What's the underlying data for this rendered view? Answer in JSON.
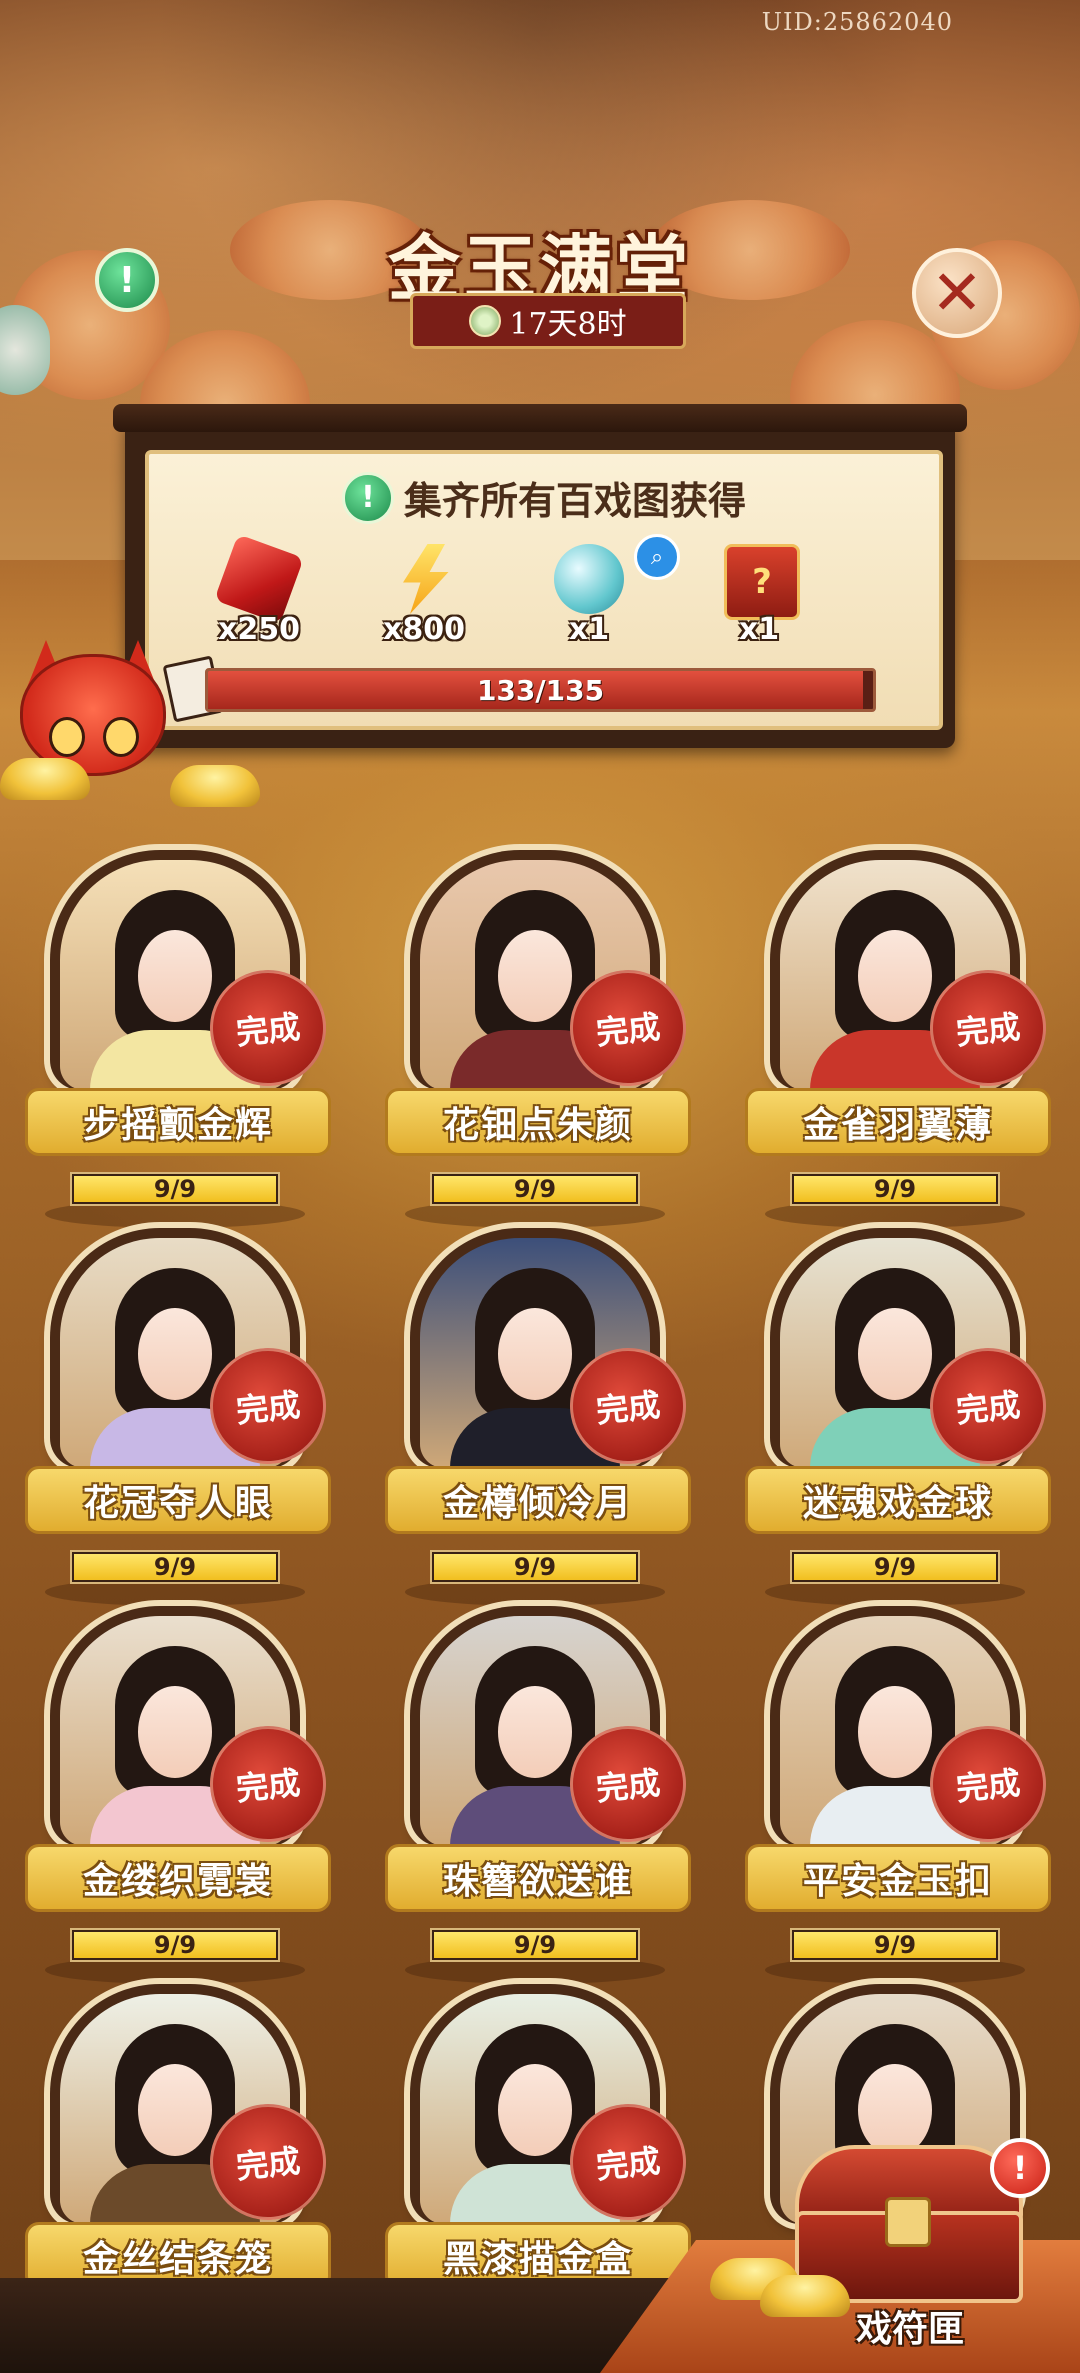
{
  "header": {
    "uid": "UID:25862040",
    "title": "金玉满堂",
    "timer": "17天8时"
  },
  "reward_panel": {
    "heading": "集齐所有百戏图获得",
    "rewards": [
      {
        "icon": "red-gem-icon",
        "qty": "x250"
      },
      {
        "icon": "lightning-icon",
        "qty": "x800"
      },
      {
        "icon": "spirit-orb-icon",
        "qty": "x1"
      },
      {
        "icon": "mystery-chest-icon",
        "qty": "x1"
      }
    ],
    "progress": {
      "text": "133/135",
      "current": 133,
      "total": 135
    }
  },
  "colors": {
    "accent_red": "#a8221a",
    "gold": "#f1bf1f",
    "panel": "#fbf1d7"
  },
  "cards": [
    {
      "name": "步摇颤金辉",
      "status": "完成",
      "progress": "9/9",
      "fraction": 1,
      "skin": "#f5e0b8",
      "outfit": "#f3e6a2"
    },
    {
      "name": "花钿点朱颜",
      "status": "完成",
      "progress": "9/9",
      "fraction": 1,
      "skin": "#e9c8ad",
      "outfit": "#7a2a2a"
    },
    {
      "name": "金雀羽翼薄",
      "status": "完成",
      "progress": "9/9",
      "fraction": 1,
      "skin": "#f0e2cc",
      "outfit": "#c9362a"
    },
    {
      "name": "花冠夺人眼",
      "status": "完成",
      "progress": "9/9",
      "fraction": 1,
      "skin": "#e8dcc6",
      "outfit": "#c8b8e6"
    },
    {
      "name": "金樽倾冷月",
      "status": "完成",
      "progress": "9/9",
      "fraction": 1,
      "skin": "#3c4f7a",
      "outfit": "#1f1f2a"
    },
    {
      "name": "迷魂戏金球",
      "status": "完成",
      "progress": "9/9",
      "fraction": 1,
      "skin": "#e7e3d3",
      "outfit": "#7fd0b8"
    },
    {
      "name": "金缕织霓裳",
      "status": "完成",
      "progress": "9/9",
      "fraction": 1,
      "skin": "#eadfce",
      "outfit": "#f3c6d0"
    },
    {
      "name": "珠簪欲送谁",
      "status": "完成",
      "progress": "9/9",
      "fraction": 1,
      "skin": "#d7d4d0",
      "outfit": "#5e4d7a"
    },
    {
      "name": "平安金玉扣",
      "status": "完成",
      "progress": "9/9",
      "fraction": 1,
      "skin": "#e5d3bb",
      "outfit": "#e8eef2"
    },
    {
      "name": "金丝结条笼",
      "status": "完成",
      "progress": "",
      "fraction": 1,
      "skin": "#eef0e6",
      "outfit": "#6b4a2a"
    },
    {
      "name": "黑漆描金盒",
      "status": "完成",
      "progress": "",
      "fraction": 1,
      "skin": "#e8efe4",
      "outfit": "#cfe3d6"
    },
    {
      "name": "",
      "status": "",
      "progress": "",
      "fraction": 1,
      "skin": "#e7dccb",
      "outfit": "#f4f0ea"
    }
  ],
  "chest": {
    "label": "戏符匣",
    "alert": "!"
  }
}
